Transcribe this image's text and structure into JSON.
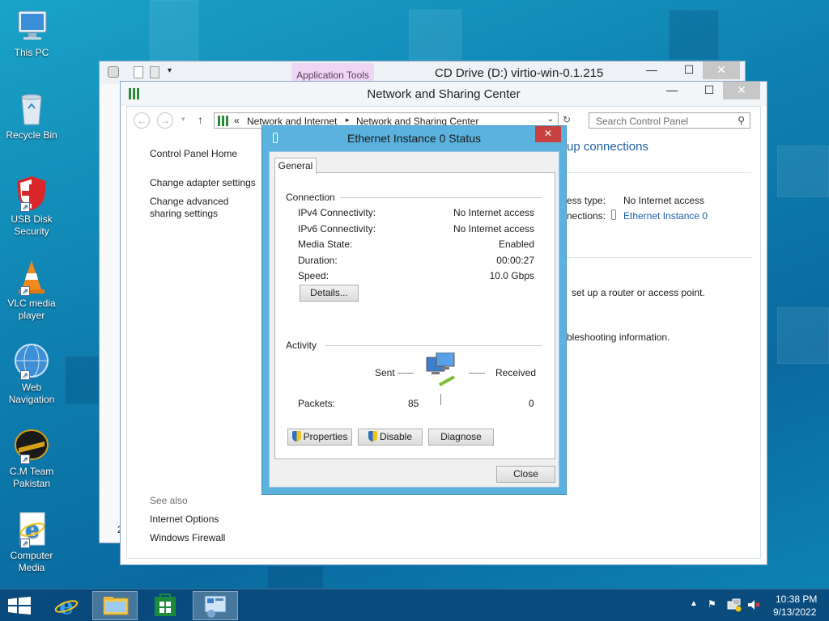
{
  "desktop_icons": [
    {
      "label": "This PC"
    },
    {
      "label": "Recycle Bin"
    },
    {
      "label": "USB Disk Security"
    },
    {
      "label": "VLC media player"
    },
    {
      "label": "Web Navigation"
    },
    {
      "label": "C.M Team Pakistan"
    },
    {
      "label": "Computer Media"
    }
  ],
  "cd_window": {
    "title": "CD Drive (D:) virtio-win-0.1.215",
    "ribbon_tab": "Application Tools"
  },
  "cp_window": {
    "title": "Network and Sharing Center",
    "breadcrumb": [
      "Network and Internet",
      "Network and Sharing Center"
    ],
    "search_placeholder": "Search Control Panel",
    "sidebar": {
      "home": "Control Panel Home",
      "links": [
        "Change adapter settings",
        "Change advanced sharing settings"
      ],
      "see_also_header": "See also",
      "see_also": [
        "Internet Options",
        "Windows Firewall"
      ]
    },
    "main": {
      "heading_fragment": "up connections",
      "access_type_label": "ess type:",
      "access_type_value": "No Internet access",
      "connections_label": "nections:",
      "connections_value": "Ethernet Instance 0",
      "setup_text": "set up a router or access point.",
      "troubleshoot_text": "bleshooting information."
    },
    "bottom_left_char": "2"
  },
  "dialog": {
    "title": "Ethernet Instance 0 Status",
    "tab": "General",
    "connection_header": "Connection",
    "rows": [
      {
        "label": "IPv4 Connectivity:",
        "value": "No Internet access"
      },
      {
        "label": "IPv6 Connectivity:",
        "value": "No Internet access"
      },
      {
        "label": "Media State:",
        "value": "Enabled"
      },
      {
        "label": "Duration:",
        "value": "00:00:27"
      },
      {
        "label": "Speed:",
        "value": "10.0 Gbps"
      }
    ],
    "details_button": "Details...",
    "activity_header": "Activity",
    "sent_label": "Sent",
    "received_label": "Received",
    "packets_label": "Packets:",
    "packets_sent": "85",
    "packets_received": "0",
    "buttons": {
      "properties": "Properties",
      "disable": "Disable",
      "diagnose": "Diagnose",
      "close": "Close"
    }
  },
  "taskbar": {
    "time": "10:38 PM",
    "date": "9/13/2022"
  },
  "colors": {
    "accent": "#1e5fa8",
    "dialog_frame": "#5bb2de",
    "close_red": "#c74141"
  }
}
